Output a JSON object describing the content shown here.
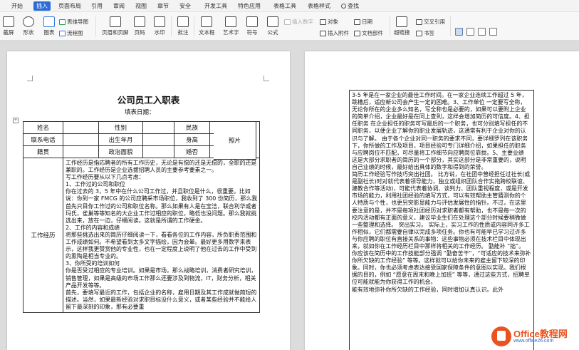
{
  "menu": {
    "tabs": [
      "开始",
      "插入",
      "页面布局",
      "引用",
      "审阅",
      "视图",
      "章节",
      "安全",
      "开发工具",
      "特色应用",
      "表格工具",
      "表格样式"
    ],
    "active": "插入",
    "search": "查找"
  },
  "ribbon": {
    "screenshot": "截屏",
    "shape": "形状",
    "chart": "图表",
    "mindmap": "思维导图",
    "flowchart": "流程图",
    "header_footer": "页眉和页脚",
    "page_number": "页码",
    "watermark": "水印",
    "comment": "批注",
    "textbox": "文本框",
    "wordart": "艺术字",
    "symbol": "符号",
    "formula": "公式",
    "insert_number": "插入数字",
    "object": "对象",
    "date": "日期",
    "insert_attachment": "插入附件",
    "doc_parts": "文档部件",
    "hyperlink": "超链接",
    "cross_ref": "交叉引用",
    "bookmark": "书签"
  },
  "document": {
    "title": "公司员工入职表",
    "date_label": "填表日期：",
    "anchor": "+",
    "table": {
      "row1": [
        "姓名",
        "",
        "性别",
        "",
        "民族",
        ""
      ],
      "row2": [
        "联系电话",
        "",
        "出生年月",
        "",
        "身高",
        ""
      ],
      "row3": [
        "籍贯",
        "",
        "政治面貌",
        "",
        "婚否",
        ""
      ],
      "photo": "照片",
      "exp_label": "工作经历",
      "exp_lines": [
        "工作经历是指応聘者的所有工作历史，无论是有偿的还是无偿的，全职的还是兼职的。工作经历是企业选拔招聘人员的主要参考要素之一。",
        "写工作经历要从以下几点考虑：",
        "1、工作过的公司和职位",
        "你在过去的 3，5 年中在什么公司工作过，并且职位是什么，很重要。比如说：你到一家 FMCG 的公司应聘采市场职位，我收到了 300 份简历，那么我首先只目你工作过的公司和职位名称。那么如果有人是在宝洁，联合利华或者玛氏，雀巢等等知名的大企业工作过相应的职位，略低也没问题。那么我就挑选出来，放在一边，仔细阅读。这就是所谓的工作硬金。",
        "2、工作的内容和成绩",
        "将那些挑选出来的简历仔细阅读一下，看看各位的工作内容，所负职责范围和工作成绩如何。不希望看到太多文字描绘，因为会晕。最好更多用数字来表示，这样我更赞赏他的专业性，也在一定程度上说明了他在过去的工作中受到的熏陶是相当专业的。",
        "3、你所受的培训如何",
        "你是否受过相应的专业培训。如果是市场，那么战略培训，消费者研究培训，销售管理，如果是高级的市场工作那么还要涉及到物流，IT，财务分析，相关产品开发等等。",
        "首先，要填写最近的工作，包括企业的名称，雇用日期及其工作成就做简短的描述。当然，如果最新经验对求职目标没什么意义，或者某些经验并不能给人留下最深刻的印象，那有必要重"
      ]
    }
  },
  "page2": {
    "paragraphs": [
      "3-5 年是在一家企业的最佳工作时间。在一家企业连续工作超过 5 年，跳槽后，适应新公司会产生一定的困难。3、工作单位 一定要写全称，无论你所在的企业多么知名，写全称也是必要的，如果可以要附上企业的简单介绍，企业最好是在同上查到，这样会增加简历的可信度。4、担任职务 在企业担任的职务可写最后的一个职务，也可分别填写担任的不同职务，以便企业了解你的职业发展轨迹，这通常有利于企业对你的认识与了解。 由于各个企业对同一职务的要求不同，要详细罗列在该职务下，你所做的工作及项目，项目经验可专门详细介绍，如果担任的职务与应聘岗位不匹配，可尽量将工作细节向应聘岗位靠拢。5、主要业绩 这是大部分求职者的简历的一个部分，其实这部分是非常重要的，说明自己业绩的时候，最好给出具体的数字和得到的荣誉。",
      "简历工作经验写作技巧突出社团。 比方说，在社团中曾经担任过社长(或是副社长)时对就代表着领导能力，独立或组织团队合作实拖跨校联谊、建教合作等活动)，可能代表着协调、谈判力、团队重视程度，或是开发市场的能力，利用社团经验的填写方式，可以有效帮助主管猜测你的个人特质与个性，也更另突影显能力与评估发展性的指针。不过，在这里要注意的是，并不是每项社团经历对求职者都有帮助，也不是每一次的校内活动都有正面的意义，建议毕业生们在处理这个部分时候要稍微做一些整理和选择。 突出实习。 实际上，实习工作的性质或内容同许多工作相似，它们都需要自律以完成多项任务。你也有可能早已学习过许多与你应聘的职位有直接关系的事物：这些事物必须在技术栏目中体现出来，就如你在工作经历栏目中那样将相关的工作经历。 勤能补 “拙”。 你应该在简历中的工作技能部分强调 “勤奋苦干”，“可适应的技术来弥补你所欠缺的工作经验” 等等。这样就可以给你未来的雇主留下较深的印象。同时，你也必须考虑表达接受国家保障条件的意图以实现。我们根据的目的，例如 “愿意在周末和晚上加班” 等等，通过这些方式，招聘单位可能就能为你获得工作的机会。",
      "能有效地弥补你所欠缺的工作经验，同时增加认真认识。此外"
    ]
  },
  "watermark": {
    "brand": "Office教程网",
    "sub": "www.office26.com"
  },
  "colors": {
    "accent": "#2b6bd6",
    "watermark_orange": "#e8531f",
    "watermark_blue": "#2a66c9"
  }
}
